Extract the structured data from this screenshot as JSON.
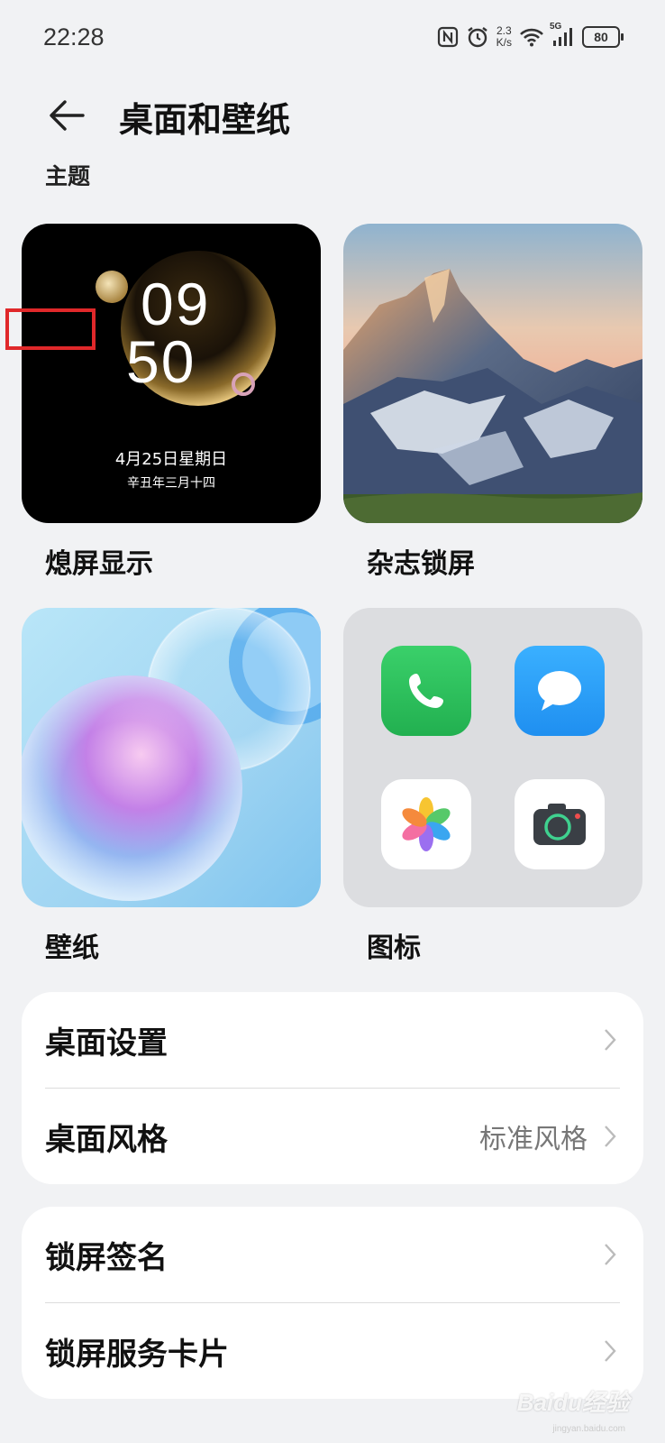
{
  "status_bar": {
    "time": "22:28",
    "net_speed_value": "2.3",
    "net_speed_unit": "K/s",
    "network_type": "5G",
    "battery": "80",
    "icons": [
      "nfc-icon",
      "alarm-icon",
      "wifi-icon",
      "signal-icon",
      "battery-icon"
    ]
  },
  "header": {
    "title": "桌面和壁纸",
    "back_icon": "back-arrow-icon"
  },
  "theme_section": {
    "label": "主题",
    "tiles": [
      {
        "label": "熄屏显示",
        "preview": {
          "hour": "09",
          "minute": "50",
          "date": "4月25日星期日",
          "lunar": "辛丑年三月十四"
        }
      },
      {
        "label": "杂志锁屏"
      },
      {
        "label": "壁纸"
      },
      {
        "label": "图标",
        "icons": [
          "phone-app-icon",
          "messages-app-icon",
          "gallery-app-icon",
          "camera-app-icon"
        ]
      }
    ]
  },
  "settings_group_1": [
    {
      "label": "桌面设置",
      "value": ""
    },
    {
      "label": "桌面风格",
      "value": "标准风格"
    }
  ],
  "settings_group_2": [
    {
      "label": "锁屏签名",
      "value": ""
    },
    {
      "label": "锁屏服务卡片",
      "value": ""
    }
  ],
  "watermark": {
    "text": "Baidu经验",
    "sub": "jingyan.baidu.com"
  },
  "colors": {
    "background": "#f1f2f4",
    "card": "#ffffff",
    "annotation_red": "#e0282a",
    "phone_green": "#2fbf5a",
    "messages_blue": "#2b9cf5"
  }
}
